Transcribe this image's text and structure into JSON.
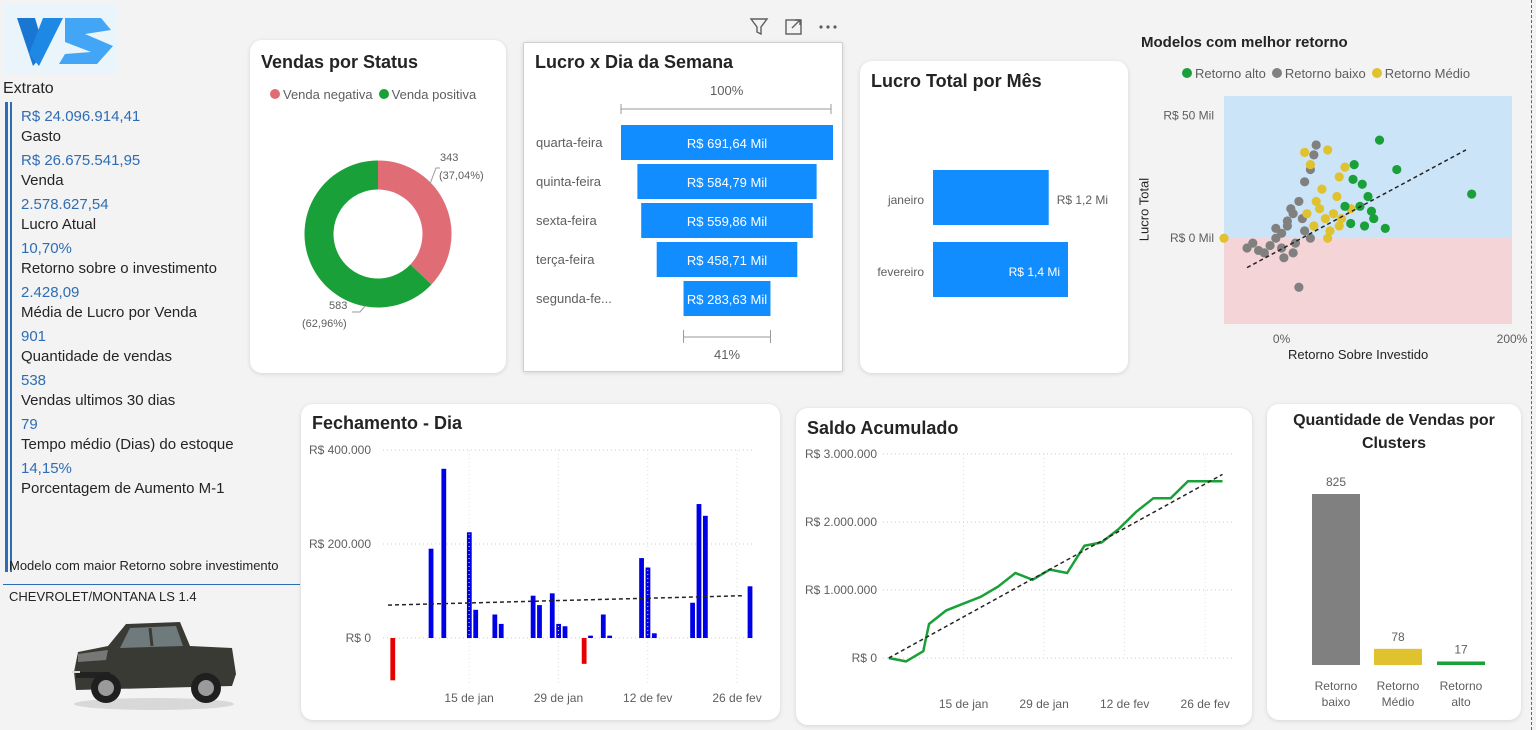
{
  "logo": {
    "icon": "vs-logo-icon"
  },
  "extrato": {
    "title": "Extrato",
    "kpis": [
      {
        "value": "R$ 24.096.914,41",
        "label": "Gasto"
      },
      {
        "value": "R$ 26.675.541,95",
        "label": "Venda"
      },
      {
        "value": "2.578.627,54",
        "label": "Lucro Atual"
      },
      {
        "value": "10,70%",
        "label": "Retorno sobre o investimento"
      },
      {
        "value": "2.428,09",
        "label": "Média de Lucro por Venda"
      },
      {
        "value": "901",
        "label": "Quantidade de vendas"
      },
      {
        "value": "538",
        "label": "Vendas ultimos 30 dias"
      },
      {
        "value": "79",
        "label": "Tempo médio (Dias) do estoque"
      },
      {
        "value": "14,15%",
        "label": "Porcentagem de Aumento M-1"
      }
    ],
    "model_header": "Modelo com maior Retorno sobre investimento",
    "model_name": "CHEVROLET/MONTANA LS 1.4"
  },
  "colors": {
    "blue_bar": "#118dff",
    "dark_blue_bar": "#0000e6",
    "red": "#e60000",
    "green": "#1aa038",
    "pink": "#e06c75",
    "gray": "#808080",
    "yellow": "#e0c12e",
    "kpi_blue": "#2e6db4"
  },
  "visual_toolbar": {
    "filter_icon": "filter-icon",
    "focus_icon": "focus-mode-icon",
    "more_icon": "more-options-icon"
  },
  "charts": {
    "status": {
      "title": "Vendas por Status",
      "legend": [
        "Venda negativa",
        "Venda positiva"
      ],
      "neg_label": "343",
      "neg_pct": "(37,04%)",
      "pos_label": "583",
      "pos_pct": "(62,96%)"
    },
    "funnel": {
      "title": "Lucro x Dia da Semana",
      "top_label": "100%",
      "bottom_label": "41%"
    },
    "month": {
      "title": "Lucro Total por Mês"
    },
    "scatter": {
      "title": "Modelos com melhor retorno",
      "legend": [
        "Retorno alto",
        "Retorno baixo",
        "Retorno Médio"
      ],
      "y_axis_label": "Lucro Total",
      "x_axis_label": "Retorno Sobre Investido",
      "y_ticks": [
        "R$ 50 Mil",
        "R$ 0 Mil"
      ],
      "x_ticks": [
        "0%",
        "200%"
      ]
    },
    "daily": {
      "title": "Fechamento - Dia",
      "y_ticks": [
        "R$ 400.000",
        "R$ 200.000",
        "R$ 0"
      ],
      "x_ticks": [
        "15 de jan",
        "29 de jan",
        "12 de fev",
        "26 de fev"
      ]
    },
    "cumulative": {
      "title": "Saldo Acumulado",
      "y_ticks": [
        "R$ 3.000.000",
        "R$ 2.000.000",
        "R$ 1.000.000",
        "R$ 0"
      ],
      "x_ticks": [
        "15 de jan",
        "29 de jan",
        "12 de fev",
        "26 de fev"
      ]
    },
    "clusters": {
      "title_line1": "Quantidade de Vendas por",
      "title_line2": "Clusters",
      "categories": [
        [
          "Retorno",
          "baixo"
        ],
        [
          "Retorno",
          "Médio"
        ],
        [
          "Retorno",
          "alto"
        ]
      ],
      "value_labels": [
        "825",
        "78",
        "17"
      ]
    }
  },
  "chart_data": [
    {
      "type": "pie",
      "title": "Vendas por Status",
      "categories": [
        "Venda negativa",
        "Venda positiva"
      ],
      "values": [
        343,
        583
      ],
      "percentages": [
        37.04,
        62.96
      ],
      "colors": [
        "#e06c75",
        "#1aa038"
      ],
      "legend": "top"
    },
    {
      "type": "bar",
      "title": "Lucro x Dia da Semana",
      "categories": [
        "quarta-feira",
        "quinta-feira",
        "sexta-feira",
        "terça-feira",
        "segunda-fe..."
      ],
      "values": [
        691.64,
        584.79,
        559.86,
        458.71,
        283.63
      ],
      "value_labels": [
        "R$ 691,64 Mil",
        "R$ 584,79 Mil",
        "R$ 559,86 Mil",
        "R$ 458,71 Mil",
        "R$ 283,63 Mil"
      ]
    },
    {
      "type": "bar",
      "title": "Lucro Total por Mês",
      "categories": [
        "janeiro",
        "fevereiro"
      ],
      "values": [
        1.2,
        1.4
      ],
      "value_labels": [
        "R$ 1,2 Mi",
        "R$ 1,4 Mi"
      ]
    },
    {
      "type": "scatter",
      "title": "Modelos com melhor retorno",
      "xlabel": "Retorno Sobre Investido",
      "ylabel": "Lucro Total",
      "xlim": [
        -0.5,
        2.0
      ],
      "ylim": [
        -35000,
        58000
      ],
      "series": [
        {
          "name": "Retorno alto",
          "color": "#1aa038",
          "points": [
            [
              0.85,
              40000
            ],
            [
              1.0,
              28000
            ],
            [
              1.65,
              18000
            ],
            [
              0.7,
              22000
            ],
            [
              0.75,
              17000
            ],
            [
              0.62,
              24000
            ],
            [
              0.8,
              8000
            ],
            [
              0.55,
              13000
            ],
            [
              0.68,
              13000
            ],
            [
              0.9,
              4000
            ],
            [
              0.72,
              5000
            ],
            [
              0.6,
              6000
            ],
            [
              0.78,
              11000
            ],
            [
              0.63,
              30000
            ]
          ]
        },
        {
          "name": "Retorno baixo",
          "color": "#808080",
          "points": [
            [
              0.3,
              38000
            ],
            [
              0.28,
              34000
            ],
            [
              0.25,
              28000
            ],
            [
              0.2,
              23000
            ],
            [
              0.15,
              15000
            ],
            [
              0.1,
              10000
            ],
            [
              0.05,
              5000
            ],
            [
              0.0,
              2000
            ],
            [
              -0.05,
              0
            ],
            [
              -0.1,
              -3000
            ],
            [
              -0.2,
              -5000
            ],
            [
              -0.3,
              -4000
            ],
            [
              -0.15,
              -6000
            ],
            [
              0.02,
              -8000
            ],
            [
              0.1,
              -6000
            ],
            [
              0.15,
              -20000
            ],
            [
              0.05,
              7000
            ],
            [
              0.2,
              3000
            ],
            [
              0.25,
              0
            ],
            [
              -0.05,
              4000
            ],
            [
              0.08,
              12000
            ],
            [
              0.18,
              8000
            ],
            [
              0.12,
              -2000
            ],
            [
              -0.25,
              -2000
            ],
            [
              0.0,
              -4000
            ]
          ]
        },
        {
          "name": "Retorno Médio",
          "color": "#e0c12e",
          "points": [
            [
              0.2,
              35000
            ],
            [
              0.25,
              30000
            ],
            [
              0.4,
              36000
            ],
            [
              0.5,
              25000
            ],
            [
              0.55,
              29000
            ],
            [
              0.35,
              20000
            ],
            [
              0.3,
              15000
            ],
            [
              0.45,
              10000
            ],
            [
              0.5,
              5000
            ],
            [
              0.6,
              12000
            ],
            [
              0.38,
              8000
            ],
            [
              0.28,
              5000
            ],
            [
              0.42,
              3000
            ],
            [
              -0.5,
              0
            ],
            [
              0.33,
              12000
            ],
            [
              0.48,
              17000
            ],
            [
              0.22,
              10000
            ],
            [
              0.4,
              0
            ],
            [
              0.52,
              8000
            ]
          ]
        }
      ],
      "legend": "top",
      "trendline": "dashed"
    },
    {
      "type": "bar",
      "title": "Fechamento - Dia",
      "x": [
        "2025-01-02",
        "2025-01-03",
        "2025-01-04",
        "2025-01-05",
        "2025-01-06",
        "2025-01-07",
        "2025-01-08",
        "2025-01-09",
        "2025-01-10",
        "2025-01-11",
        "2025-01-12",
        "2025-01-13",
        "2025-01-14",
        "2025-01-15",
        "2025-01-16",
        "2025-01-17",
        "2025-01-18",
        "2025-01-19",
        "2025-01-20",
        "2025-01-21",
        "2025-01-22",
        "2025-01-23",
        "2025-01-24",
        "2025-01-25",
        "2025-01-26",
        "2025-01-27",
        "2025-01-28",
        "2025-01-29",
        "2025-01-30",
        "2025-01-31",
        "2025-02-01",
        "2025-02-02",
        "2025-02-03",
        "2025-02-04",
        "2025-02-05",
        "2025-02-06",
        "2025-02-07",
        "2025-02-08",
        "2025-02-09",
        "2025-02-10",
        "2025-02-11",
        "2025-02-12",
        "2025-02-13",
        "2025-02-14",
        "2025-02-15",
        "2025-02-16",
        "2025-02-17",
        "2025-02-18",
        "2025-02-19",
        "2025-02-20",
        "2025-02-21",
        "2025-02-22",
        "2025-02-23",
        "2025-02-24",
        "2025-02-25",
        "2025-02-26",
        "2025-02-27",
        "2025-02-28"
      ],
      "values": [
        0,
        -90000,
        0,
        0,
        0,
        0,
        0,
        190000,
        0,
        360000,
        0,
        0,
        0,
        225000,
        60000,
        0,
        0,
        50000,
        30000,
        0,
        0,
        0,
        0,
        90000,
        70000,
        0,
        95000,
        30000,
        25000,
        0,
        0,
        -55000,
        5000,
        0,
        50000,
        5000,
        0,
        0,
        0,
        0,
        170000,
        150000,
        10000,
        0,
        0,
        0,
        0,
        0,
        75000,
        285000,
        260000,
        0,
        0,
        0,
        0,
        0,
        0,
        110000
      ],
      "ylabel": "",
      "ylim": [
        -100000,
        400000
      ],
      "trendline": "dashed"
    },
    {
      "type": "line",
      "title": "Saldo Acumulado",
      "x": [
        "2025-01-02",
        "2025-01-05",
        "2025-01-08",
        "2025-01-09",
        "2025-01-12",
        "2025-01-15",
        "2025-01-18",
        "2025-01-21",
        "2025-01-24",
        "2025-01-27",
        "2025-01-30",
        "2025-02-02",
        "2025-02-05",
        "2025-02-08",
        "2025-02-11",
        "2025-02-14",
        "2025-02-17",
        "2025-02-20",
        "2025-02-23",
        "2025-02-26",
        "2025-03-01"
      ],
      "values": [
        0,
        -50000,
        100000,
        500000,
        700000,
        800000,
        900000,
        1050000,
        1250000,
        1150000,
        1300000,
        1250000,
        1650000,
        1700000,
        1900000,
        2150000,
        2350000,
        2350000,
        2600000,
        2600000,
        2600000
      ],
      "ylim": [
        0,
        3000000
      ],
      "color": "#1aa038",
      "trendline": "dashed"
    },
    {
      "type": "bar",
      "title": "Quantidade de Vendas por Clusters",
      "categories": [
        "Retorno baixo",
        "Retorno Médio",
        "Retorno alto"
      ],
      "values": [
        825,
        78,
        17
      ],
      "colors": [
        "#808080",
        "#e0c12e",
        "#1aa038"
      ]
    }
  ]
}
